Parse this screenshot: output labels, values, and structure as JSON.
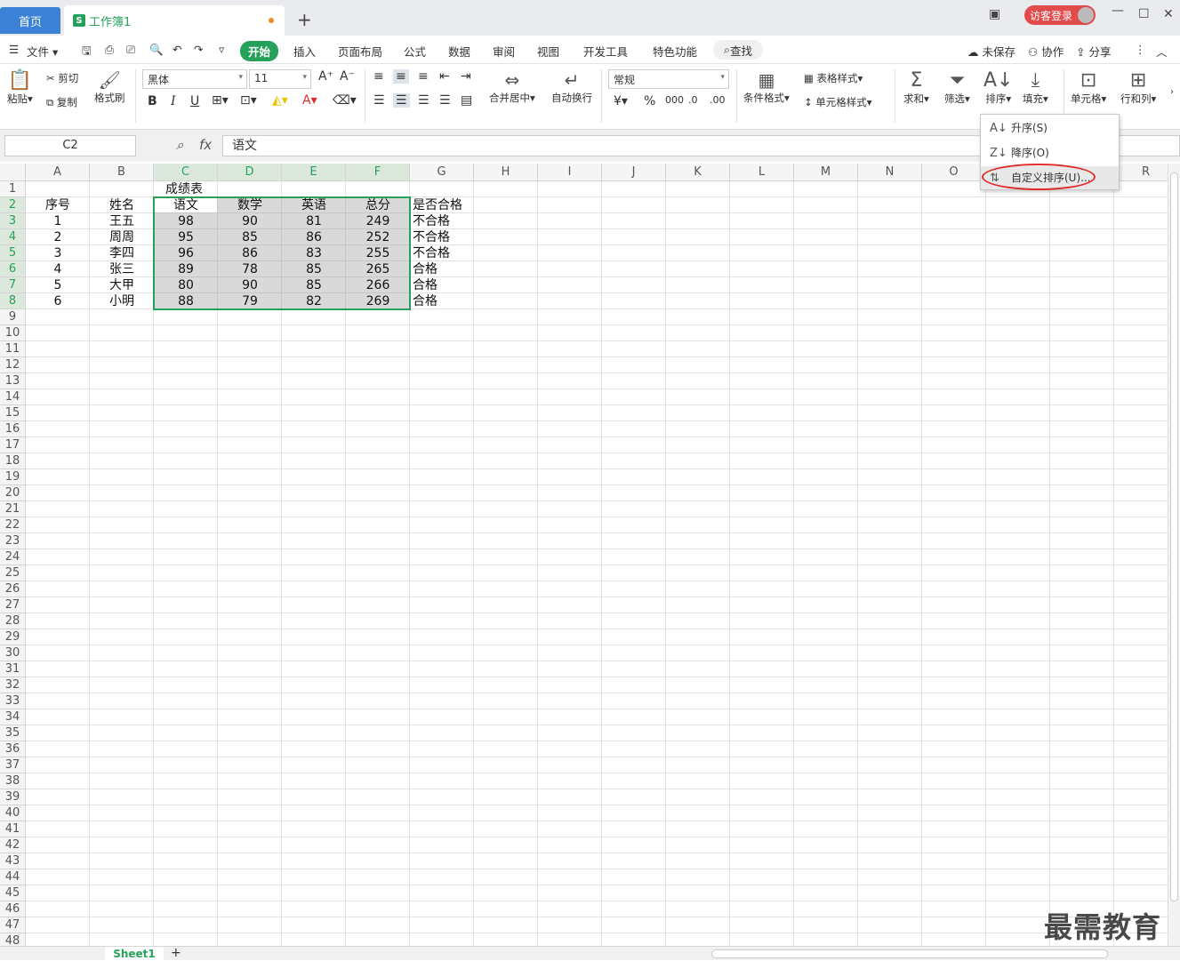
{
  "titlebar": {
    "home": "首页",
    "doc_name": "工作簿1",
    "doc_icon": "S",
    "new_tab": "+",
    "guest_login": "访客登录"
  },
  "menu": {
    "file": "文件",
    "items": [
      "开始",
      "插入",
      "页面布局",
      "公式",
      "数据",
      "审阅",
      "视图",
      "开发工具",
      "特色功能"
    ],
    "search": "查找",
    "unsaved": "未保存",
    "collab": "协作",
    "share": "分享"
  },
  "ribbon": {
    "paste": "粘贴",
    "cut": "剪切",
    "copy": "复制",
    "format_painter": "格式刷",
    "font_name": "黑体",
    "font_size": "11",
    "merge": "合并居中",
    "wrap": "自动换行",
    "number_format": "常规",
    "cond_format": "条件格式",
    "table_style": "表格样式",
    "cell_style": "单元格样式",
    "sum": "求和",
    "filter": "筛选",
    "sort": "排序",
    "fill": "填充",
    "cell": "单元格",
    "rowcol": "行和列"
  },
  "formula": {
    "name_box": "C2",
    "fx": "fx",
    "value": "语文"
  },
  "columns": [
    "A",
    "B",
    "C",
    "D",
    "E",
    "F",
    "G",
    "H",
    "I",
    "J",
    "K",
    "L",
    "M",
    "N",
    "O",
    "P",
    "Q",
    "R"
  ],
  "table": {
    "title": "成绩表",
    "headers": [
      "序号",
      "姓名",
      "语文",
      "数学",
      "英语",
      "总分",
      "是否合格"
    ],
    "rows": [
      [
        "1",
        "王五",
        "98",
        "90",
        "81",
        "249",
        "不合格"
      ],
      [
        "2",
        "周周",
        "95",
        "85",
        "86",
        "252",
        "不合格"
      ],
      [
        "3",
        "李四",
        "96",
        "86",
        "83",
        "255",
        "不合格"
      ],
      [
        "4",
        "张三",
        "89",
        "78",
        "85",
        "265",
        "合格"
      ],
      [
        "5",
        "大甲",
        "80",
        "90",
        "85",
        "266",
        "合格"
      ],
      [
        "6",
        "小明",
        "88",
        "79",
        "82",
        "269",
        "合格"
      ]
    ]
  },
  "sort_menu": {
    "asc": "升序(S)",
    "desc": "降序(O)",
    "custom": "自定义排序(U)..."
  },
  "sheet": {
    "tab": "Sheet1",
    "add": "+"
  },
  "watermark": "最需教育"
}
